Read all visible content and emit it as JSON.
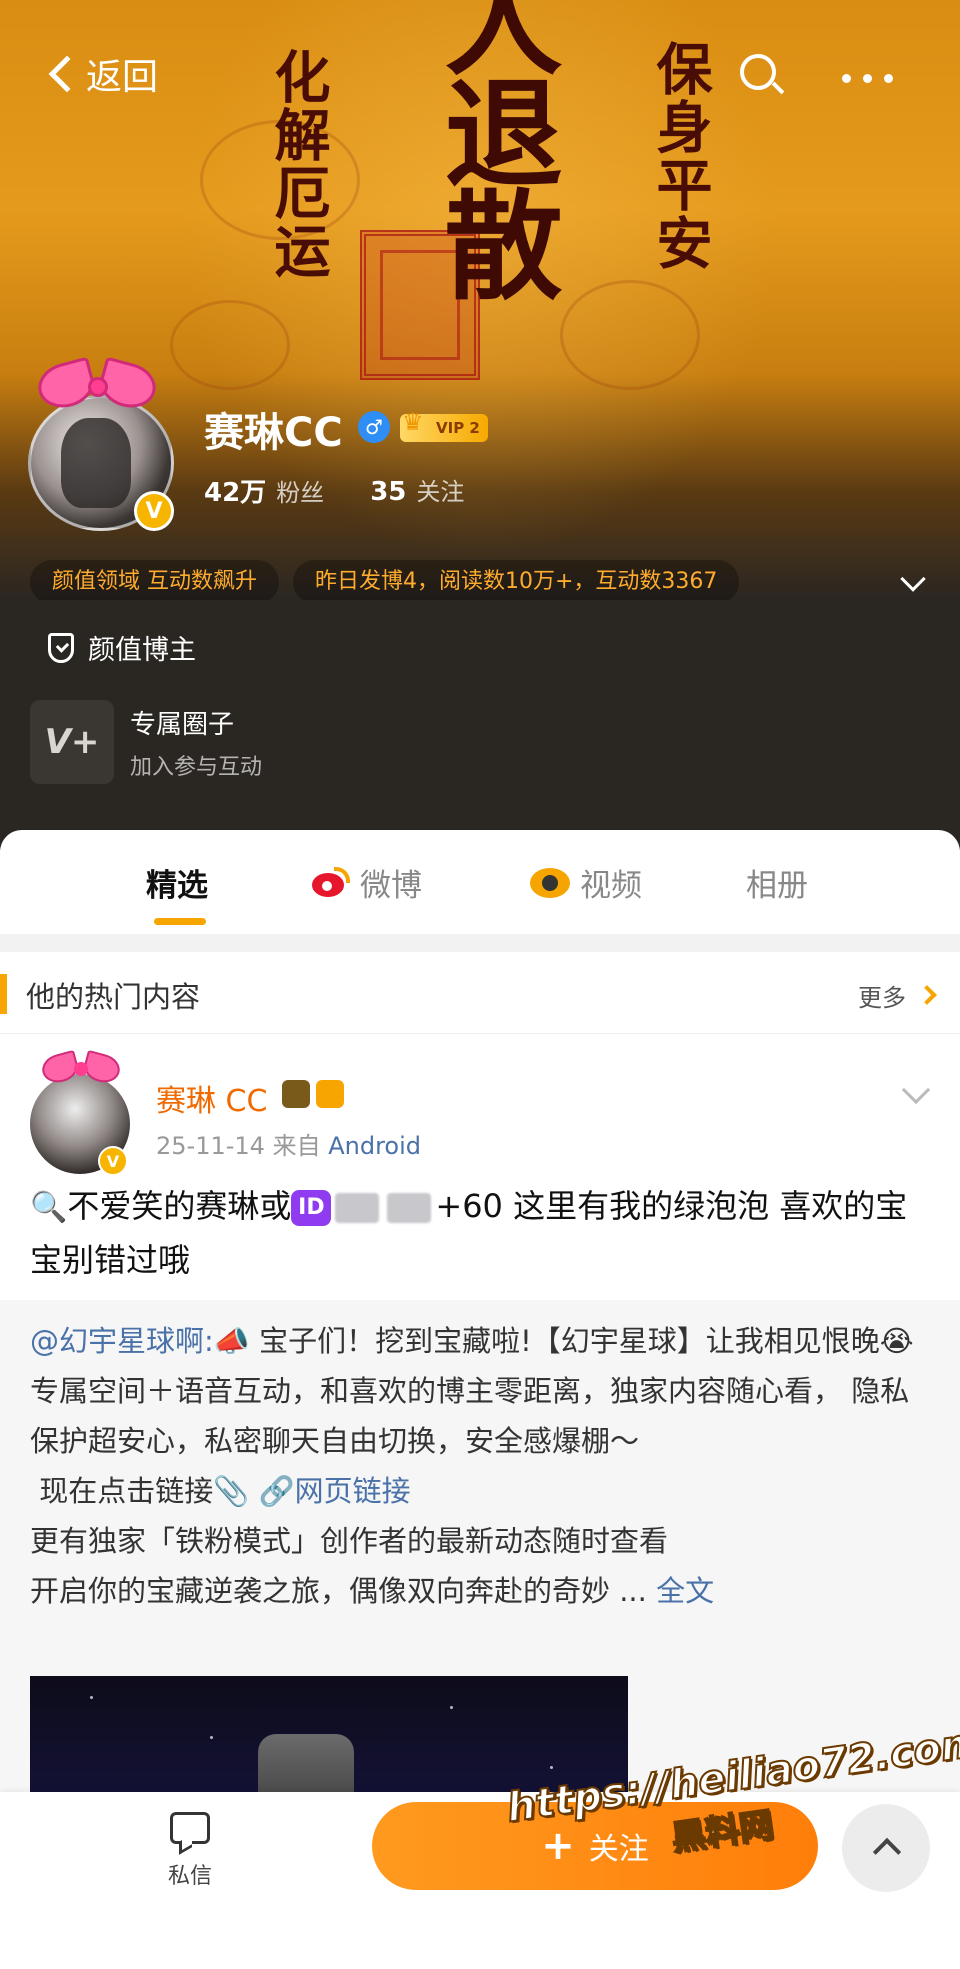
{
  "cover": {
    "calligraphy_left": "化解厄运",
    "calligraphy_right": "保身平安",
    "calligraphy_center": "人退散"
  },
  "topbar": {
    "back_label": "返回",
    "search_icon": "search-icon",
    "more_icon": "more-dots-icon"
  },
  "profile": {
    "name": "赛琳CC",
    "gender_symbol": "♂",
    "vip_label": "VIP 2",
    "verified_badge": "V",
    "followers_count": "42万",
    "followers_label": "粉丝",
    "following_count": "35",
    "following_label": "关注"
  },
  "chips": [
    "颜值领域 互动数飙升",
    "昨日发博4，阅读数10万+，互动数3367"
  ],
  "info": {
    "tag_label": "颜值博主",
    "circle_icon_text": "V+",
    "circle_title": "专属圈子",
    "circle_subtitle": "加入参与互动"
  },
  "tabs": [
    {
      "label": "精选",
      "active": true
    },
    {
      "label": "微博",
      "icon": "weibo-icon"
    },
    {
      "label": "视频",
      "icon": "video-icon"
    },
    {
      "label": "相册"
    }
  ],
  "hot": {
    "title": "他的热门内容",
    "more_label": "更多"
  },
  "post": {
    "author": "赛琳 CC",
    "verified_badge": "V",
    "date": "25-11-14",
    "source_prefix": "来自",
    "source": "Android",
    "text_part1": "不爱笑的赛琳或",
    "id_chip": "ID",
    "text_part2": "+60 这里有我的绿泡泡 喜欢的宝宝别错过哦"
  },
  "repost": {
    "mention": "@幻宇星球啊:",
    "line1": "📣 宝子们！挖到宝藏啦!【幻宇星球】让我相见恨晚😭 专属空间＋语音互动，和喜欢的博主零距离，独家内容随心看， 隐私保护超安心，私密聊天自由切换，安全感爆棚～",
    "line2": "现在点击链接📎",
    "link_label": "网页链接",
    "line3": "更有独家「铁粉模式」创作者的最新动态随时查看",
    "line4": "开启你的宝藏逆袭之旅，偶像双向奔赴的奇妙 ...",
    "full_label": "全文"
  },
  "bottom": {
    "message_label": "私信",
    "follow_plus": "+",
    "follow_label": "关注"
  },
  "watermark": {
    "url": "https://heiliao72.com",
    "site": "黑料网"
  },
  "colors": {
    "accent": "#f7a500",
    "link": "#4a72a8",
    "author": "#f06a00"
  }
}
